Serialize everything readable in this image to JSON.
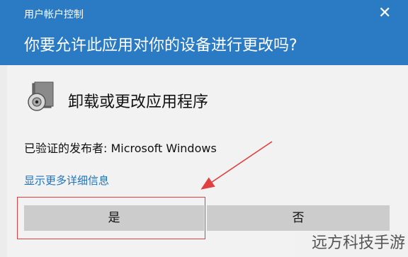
{
  "dialog": {
    "title": "用户帐户控制",
    "close_glyph": "✕",
    "question": "你要允许此应用对你的设备进行更改吗?",
    "app_name": "卸载或更改应用程序",
    "publisher": "已验证的发布者: Microsoft Windows",
    "more_details": "显示更多详细信息",
    "yes_label": "是",
    "no_label": "否"
  },
  "annotation": {
    "color": "#e04040"
  },
  "watermark": {
    "text": "远方科技手游"
  },
  "colors": {
    "header": "#2b7bc4",
    "link": "#1e73be",
    "button": "#cccccc"
  }
}
